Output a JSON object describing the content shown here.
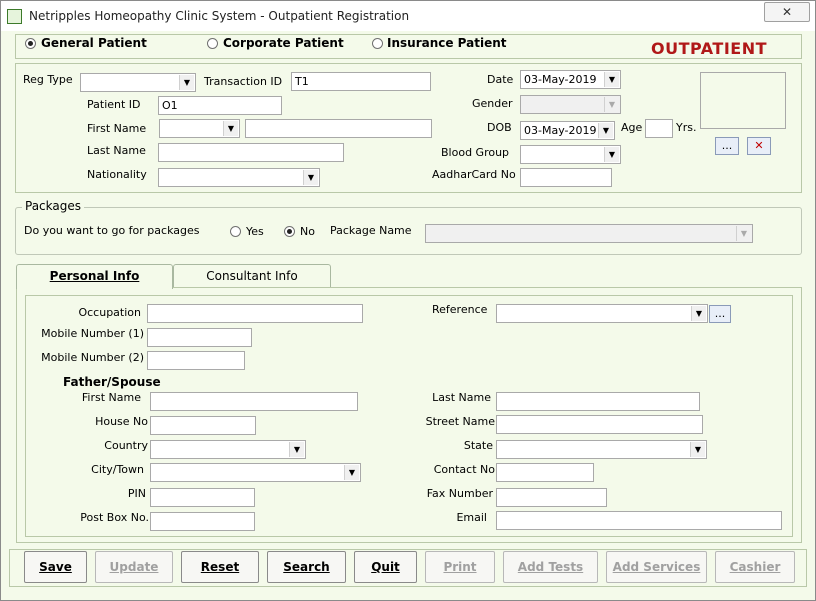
{
  "window": {
    "title": "Netripples Homeopathy Clinic System - Outpatient Registration",
    "close_glyph": "✕"
  },
  "patient_type": {
    "options": [
      {
        "label": "General Patient",
        "selected": true
      },
      {
        "label": "Corporate Patient",
        "selected": false
      },
      {
        "label": "Insurance Patient",
        "selected": false
      }
    ],
    "heading": "OUTPATIENT"
  },
  "registration": {
    "reg_type_label": "Reg Type",
    "reg_type_value": "",
    "transaction_id_label": "Transaction ID",
    "transaction_id_value": "T1",
    "date_label": "Date",
    "date_value": "03-May-2019",
    "patient_id_label": "Patient ID",
    "patient_id_value": "O1",
    "gender_label": "Gender",
    "gender_value": "",
    "first_name_label": "First Name",
    "first_name_title": "",
    "first_name_value": "",
    "dob_label": "DOB",
    "dob_value": "03-May-2019",
    "age_label": "Age",
    "age_value": "",
    "yrs_label": "Yrs.",
    "last_name_label": "Last Name",
    "last_name_value": "",
    "blood_group_label": "Blood Group",
    "blood_group_value": "",
    "nationality_label": "Nationality",
    "nationality_value": "",
    "aadhar_label": "AadharCard No",
    "aadhar_value": "",
    "browse_photo_label": "...",
    "remove_photo_label": "✕"
  },
  "packages": {
    "group_title": "Packages",
    "question": "Do you want to go for packages",
    "yes_label": "Yes",
    "yes_selected": false,
    "no_label": "No",
    "no_selected": true,
    "package_name_label": "Package Name",
    "package_name_value": ""
  },
  "tabs": [
    {
      "label": "Personal Info",
      "active": true
    },
    {
      "label": "Consultant Info",
      "active": false
    }
  ],
  "personal": {
    "occupation_label": "Occupation",
    "occupation_value": "",
    "reference_label": "Reference",
    "reference_value": "",
    "reference_browse": "...",
    "mobile1_label": "Mobile Number (1)",
    "mobile1_value": "",
    "mobile2_label": "Mobile Number (2)",
    "mobile2_value": "",
    "father_spouse_heading": "Father/Spouse",
    "fs_first_name_label": "First Name",
    "fs_first_name_value": "",
    "fs_last_name_label": "Last Name",
    "fs_last_name_value": "",
    "house_no_label": "House No",
    "house_no_value": "",
    "street_name_label": "Street Name",
    "street_name_value": "",
    "country_label": "Country",
    "country_value": "",
    "state_label": "State",
    "state_value": "",
    "city_label": "City/Town",
    "city_value": "",
    "contact_no_label": "Contact No",
    "contact_no_value": "",
    "pin_label": "PIN",
    "pin_value": "",
    "fax_label": "Fax Number",
    "fax_value": "",
    "post_box_label": "Post Box No.",
    "post_box_value": "",
    "email_label": "Email",
    "email_value": ""
  },
  "buttons": {
    "save": "Save",
    "update": "Update",
    "reset": "Reset",
    "search": "Search",
    "quit": "Quit",
    "print": "Print",
    "add_tests": "Add Tests",
    "add_services": "Add Services",
    "cashier": "Cashier"
  },
  "colors": {
    "heading_red": "#b01818",
    "panel_bg": "#f4faea"
  }
}
